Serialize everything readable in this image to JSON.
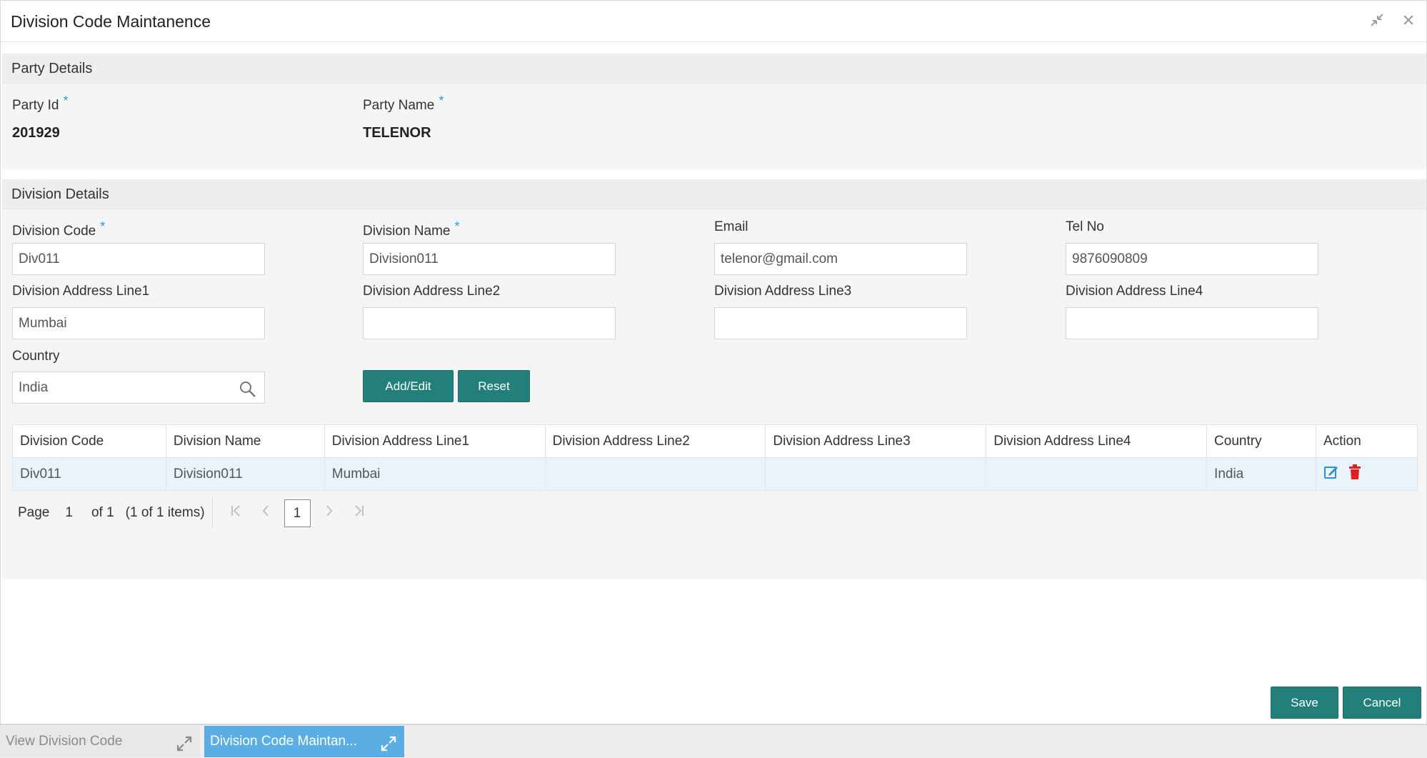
{
  "window": {
    "title": "Division Code Maintanence"
  },
  "party": {
    "section_title": "Party Details",
    "party_id_label": "Party Id",
    "party_id_value": "201929",
    "party_name_label": "Party Name",
    "party_name_value": "TELENOR",
    "required_mark": "*"
  },
  "division": {
    "section_title": "Division Details",
    "code_label": "Division Code",
    "code_value": "Div011",
    "name_label": "Division Name",
    "name_value": "Division011",
    "email_label": "Email",
    "email_value": "telenor@gmail.com",
    "tel_label": "Tel No",
    "tel_value": "9876090809",
    "addr1_label": "Division Address Line1",
    "addr1_value": "Mumbai",
    "addr2_label": "Division Address Line2",
    "addr2_value": "",
    "addr3_label": "Division Address Line3",
    "addr3_value": "",
    "addr4_label": "Division Address Line4",
    "addr4_value": "",
    "country_label": "Country",
    "country_value": "India",
    "add_edit_label": "Add/Edit",
    "reset_label": "Reset"
  },
  "table": {
    "columns": [
      "Division Code",
      "Division Name",
      "Division Address Line1",
      "Division Address Line2",
      "Division Address Line3",
      "Division Address Line4",
      "Country",
      "Action"
    ],
    "rows": [
      [
        "Div011",
        "Division011",
        "Mumbai",
        "",
        "",
        "",
        "India"
      ]
    ]
  },
  "pager": {
    "page_label": "Page",
    "page_value": "1",
    "of_label": "of 1",
    "items_label": "(1 of 1 items)",
    "current_page": "1"
  },
  "footer": {
    "save_label": "Save",
    "cancel_label": "Cancel"
  },
  "taskbar": {
    "tabs": [
      {
        "label": "View Division Code"
      },
      {
        "label": "Division Code Maintan..."
      }
    ]
  },
  "colors": {
    "accent": "#237f7a",
    "active_tab": "#5aaee3",
    "required": "#2b9ad8",
    "edit_icon": "#2b8fd6",
    "delete_icon": "#e02020"
  }
}
